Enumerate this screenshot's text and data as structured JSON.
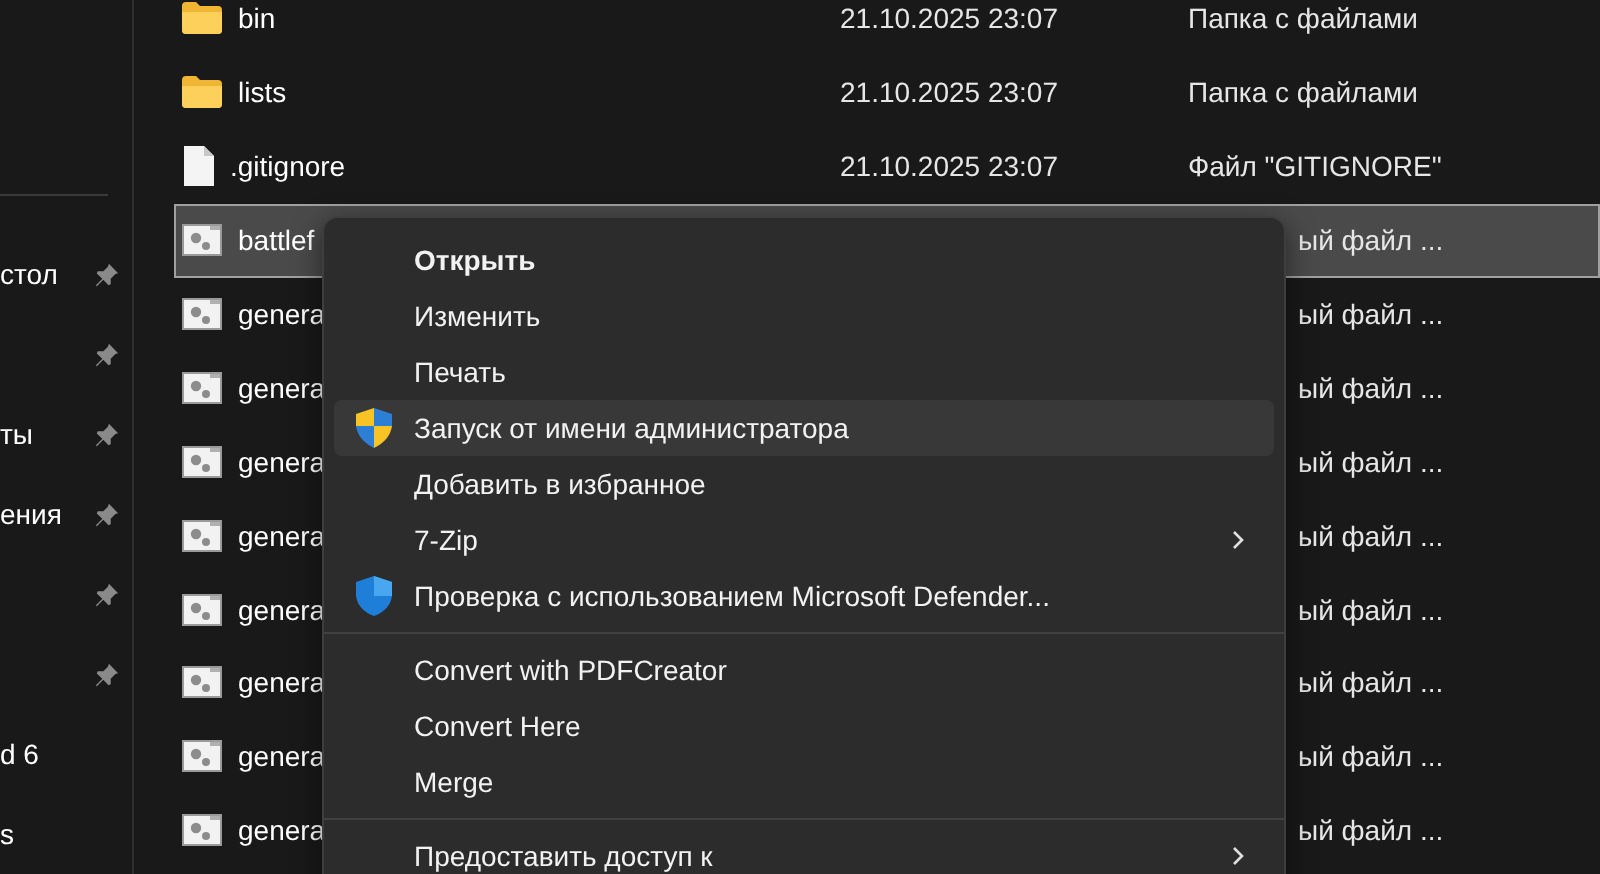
{
  "sidebar": {
    "items": [
      {
        "label": "стол",
        "pinned": true
      },
      {
        "pinned": true
      },
      {
        "label": "ты",
        "pinned": true
      },
      {
        "label": "ения",
        "pinned": true
      },
      {
        "pinned": true
      },
      {
        "pinned": true
      },
      {
        "label": "d 6",
        "pinned": false
      },
      {
        "label": "s",
        "pinned": false
      }
    ]
  },
  "files": [
    {
      "kind": "folder",
      "name": "bin",
      "date": "21.10.2025 23:07",
      "type": "Папка с файлами",
      "selected": false
    },
    {
      "kind": "folder",
      "name": "lists",
      "date": "21.10.2025 23:07",
      "type": "Папка с файлами",
      "selected": false
    },
    {
      "kind": "document",
      "name": ".gitignore",
      "date": "21.10.2025 23:07",
      "type": "Файл \"GITIGNORE\"",
      "selected": false
    },
    {
      "kind": "script",
      "name": "battlef",
      "type": "ый файл ...",
      "selected": true
    },
    {
      "kind": "script",
      "name": "genera",
      "type": "ый файл ...",
      "selected": false
    },
    {
      "kind": "script",
      "name": "genera",
      "type": "ый файл ...",
      "selected": false
    },
    {
      "kind": "script",
      "name": "genera",
      "type": "ый файл ...",
      "selected": false
    },
    {
      "kind": "script",
      "name": "genera",
      "type": "ый файл ...",
      "selected": false
    },
    {
      "kind": "script",
      "name": "genera",
      "type": "ый файл ...",
      "selected": false
    },
    {
      "kind": "script",
      "name": "genera",
      "type": "ый файл ...",
      "selected": false
    },
    {
      "kind": "script",
      "name": "genera",
      "type": "ый файл ...",
      "selected": false
    },
    {
      "kind": "script",
      "name": "genera",
      "type": "ый файл ...",
      "selected": false
    }
  ],
  "context_menu": {
    "items": [
      {
        "kind": "item",
        "label": "Открыть",
        "bold": true,
        "selected": false
      },
      {
        "kind": "item",
        "label": "Изменить",
        "bold": false,
        "selected": false
      },
      {
        "kind": "item",
        "label": "Печать",
        "bold": false,
        "selected": false
      },
      {
        "kind": "uac",
        "label": "Запуск от имени администратора",
        "bold": false,
        "selected": true
      },
      {
        "kind": "item",
        "label": "Добавить в избранное",
        "bold": false,
        "selected": false
      },
      {
        "kind": "item",
        "label": "7-Zip",
        "bold": false,
        "selected": false,
        "submenu": true
      },
      {
        "kind": "defender",
        "label": "Проверка с использованием Microsoft Defender...",
        "bold": false,
        "selected": false
      },
      {
        "kind": "separator"
      },
      {
        "kind": "item",
        "label": "Convert with PDFCreator",
        "bold": false,
        "selected": false
      },
      {
        "kind": "item",
        "label": "Convert Here",
        "bold": false,
        "selected": false
      },
      {
        "kind": "item",
        "label": "Merge",
        "bold": false,
        "selected": false
      },
      {
        "kind": "separator"
      },
      {
        "kind": "item",
        "label": "Предоставить доступ к",
        "bold": false,
        "selected": false,
        "submenu": true
      }
    ]
  }
}
